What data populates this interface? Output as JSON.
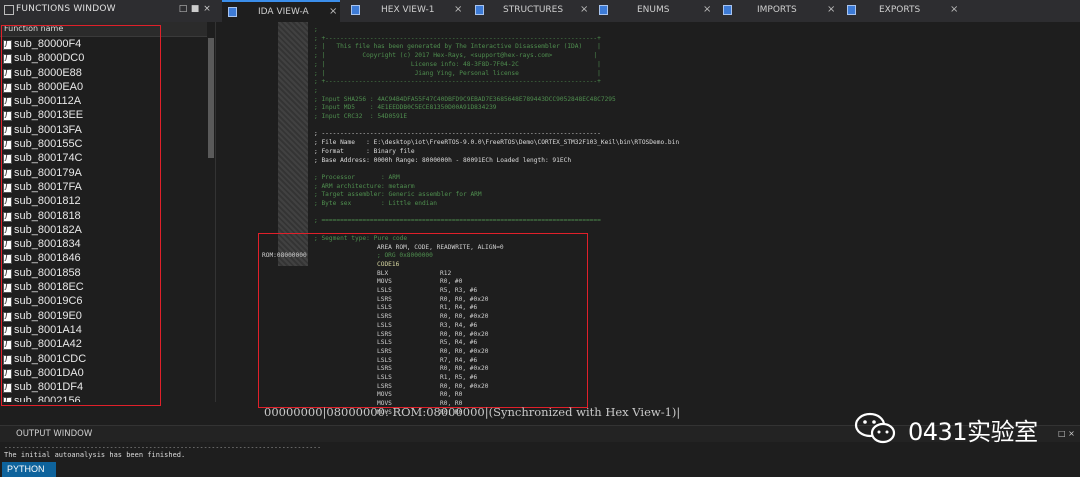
{
  "functions_window": {
    "title": "FUNCTIONS WINDOW",
    "controls": [
      "□",
      "■",
      "×"
    ],
    "column_header": "Function name",
    "items": [
      "sub_80000F4",
      "sub_8000DC0",
      "sub_8000E88",
      "sub_8000EA0",
      "sub_800112A",
      "sub_80013EE",
      "sub_80013FA",
      "sub_800155C",
      "sub_800174C",
      "sub_800179A",
      "sub_80017FA",
      "sub_8001812",
      "sub_8001818",
      "sub_800182A",
      "sub_8001834",
      "sub_8001846",
      "sub_8001858",
      "sub_80018EC",
      "sub_80019C6",
      "sub_80019E0",
      "sub_8001A14",
      "sub_8001A42",
      "sub_8001CDC",
      "sub_8001DA0",
      "sub_8001DF4",
      "sub_8002156"
    ]
  },
  "tabs": [
    {
      "label": "IDA VIEW-A",
      "close": "×"
    },
    {
      "label": "HEX VIEW-1",
      "close": "×"
    },
    {
      "label": "STRUCTURES",
      "close": "×"
    },
    {
      "label": "ENUMS",
      "close": "×"
    },
    {
      "label": "IMPORTS",
      "close": "×"
    },
    {
      "label": "EXPORTS",
      "close": "×"
    }
  ],
  "ida_view": {
    "header_lines": [
      ";",
      "; +-------------------------------------------------------------------------+",
      "; |   This file has been generated by The Interactive Disassembler (IDA)    |",
      "; |          Copyright (c) 2017 Hex-Rays, <support@hex-rays.com>           |",
      "; |                       License info: 48-3F8D-7F04-2C                     |",
      "; |                        Jiang Ying, Personal license                     |",
      "; +-------------------------------------------------------------------------+",
      ";",
      "; Input SHA256 : 4AC94B4DFA55F47C40DBFD9C9EBAD7E3685648E789443DCC9052848EC48C7295",
      "; Input MD5    : 4E1EEDDB0C5ECE81350D00A91D834239",
      "; Input CRC32  : 54D0591E",
      "",
      "; ---------------------------------------------------------------------------",
      "; File Name   : E:\\desktop\\iot\\FreeRTOS-9.0.0\\FreeRTOS\\Demo\\CORTEX_STM32F103_Keil\\bin\\RTOSDemo.bin",
      "; Format      : Binary file",
      "; Base Address: 0000h Range: 8000000h - 80091ECh Loaded length: 91ECh",
      "",
      "; Processor       : ARM",
      "; ARM architecture: metaarm",
      "; Target assembler: Generic assembler for ARM",
      "; Byte sex        : Little endian",
      "",
      "; ===========================================================================",
      "",
      "; Segment type: Pure code"
    ],
    "area_line": "AREA ROM, CODE, READWRITE, ALIGN=0",
    "rom_label": "ROM:08000000",
    "org_line": "; ORG 0x8000000",
    "code16": "CODE16",
    "instructions": [
      {
        "mnem": "BLX",
        "ops": "R12"
      },
      {
        "mnem": "MOVS",
        "ops": "R0, #0"
      },
      {
        "mnem": "LSLS",
        "ops": "R5, R3, #6"
      },
      {
        "mnem": "LSRS",
        "ops": "R0, R0, #0x20"
      },
      {
        "mnem": "LSLS",
        "ops": "R1, R4, #6"
      },
      {
        "mnem": "LSRS",
        "ops": "R0, R0, #0x20"
      },
      {
        "mnem": "LSLS",
        "ops": "R3, R4, #6"
      },
      {
        "mnem": "LSRS",
        "ops": "R0, R0, #0x20"
      },
      {
        "mnem": "LSLS",
        "ops": "R5, R4, #6"
      },
      {
        "mnem": "LSRS",
        "ops": "R0, R0, #0x20"
      },
      {
        "mnem": "LSLS",
        "ops": "R7, R4, #6"
      },
      {
        "mnem": "LSRS",
        "ops": "R0, R0, #0x20"
      },
      {
        "mnem": "LSLS",
        "ops": "R1, R5, #6"
      },
      {
        "mnem": "LSRS",
        "ops": "R0, R0, #0x20"
      },
      {
        "mnem": "MOVS",
        "ops": "R0, R0"
      },
      {
        "mnem": "MOVS",
        "ops": "R0, R0"
      },
      {
        "mnem": "MOVS",
        "ops": "R0, R0"
      }
    ],
    "status": "00000000|08000000: ROM:08000000|(Synchronized with Hex View-1)|"
  },
  "output_window": {
    "title": "OUTPUT WINDOW",
    "separator": "---------------------------------------------------------------------------------",
    "text": "The initial autoanalysis has been finished.",
    "controls": "□ ×",
    "python_button": "PYTHON"
  },
  "watermark": {
    "text": "0431实验室"
  },
  "colors": {
    "accent": "#0e639c",
    "highlight_box": "#e0202a",
    "comment": "#4f8f4f"
  }
}
